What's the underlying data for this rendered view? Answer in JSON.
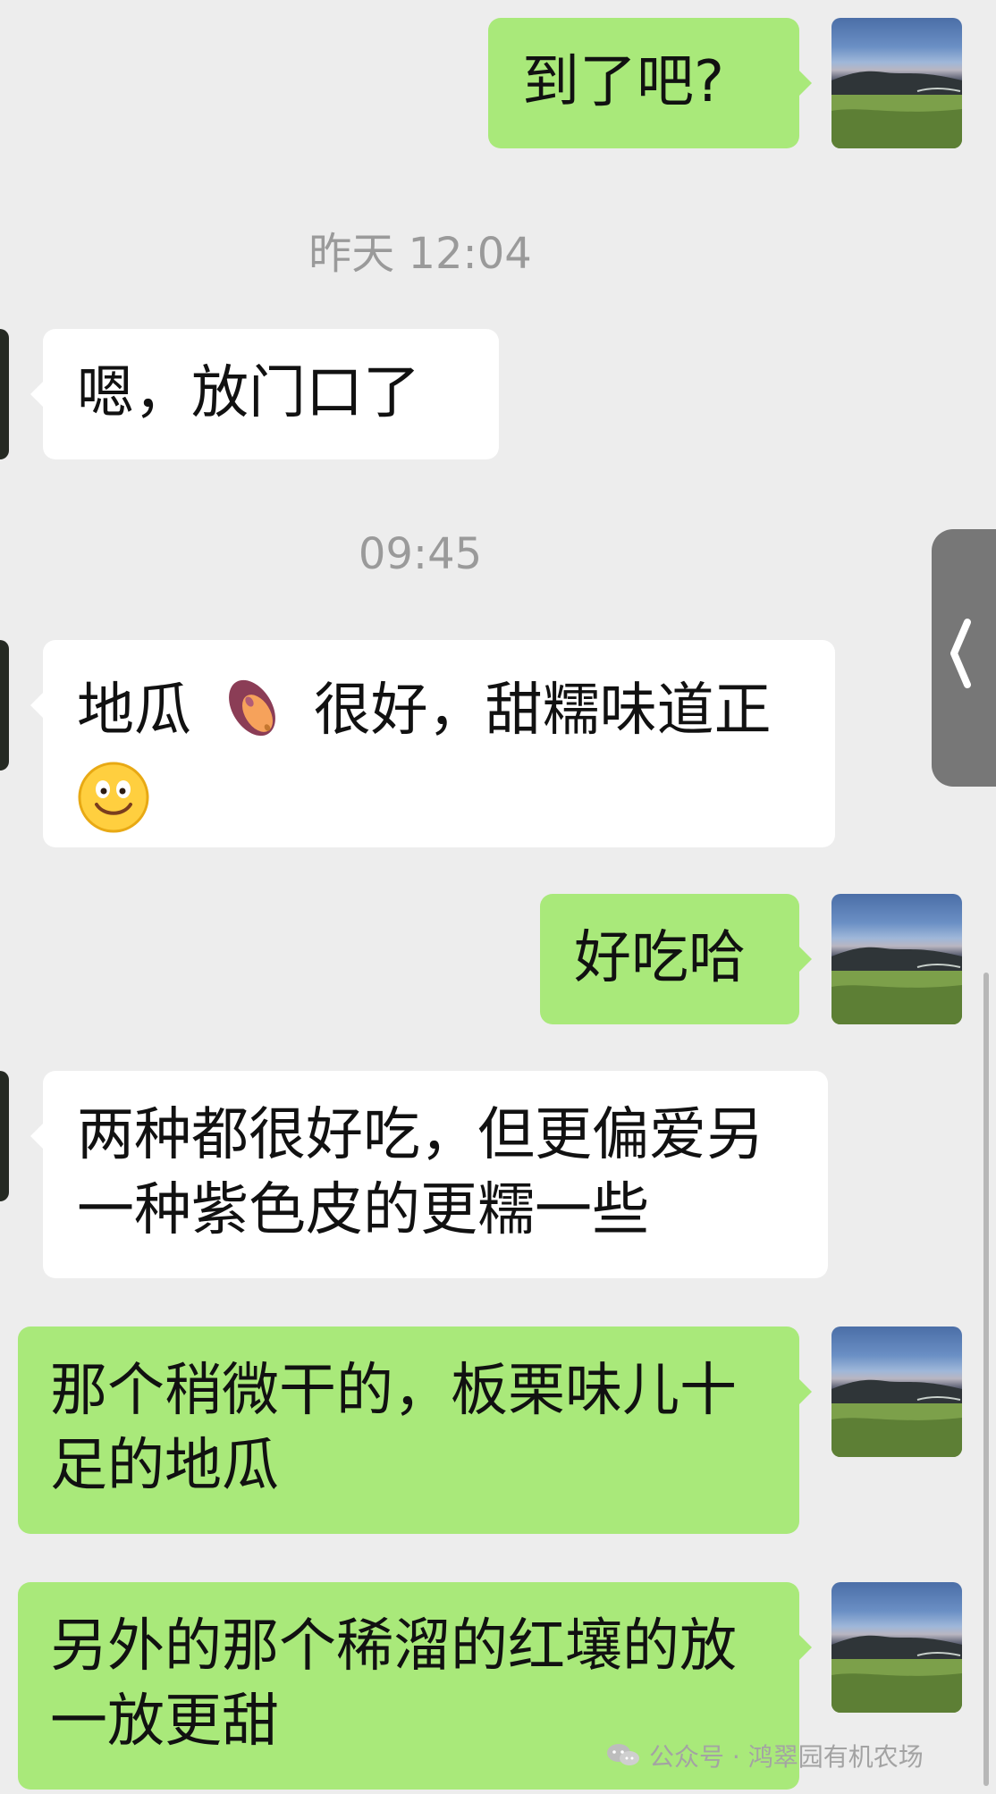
{
  "messages": [
    {
      "sender": "me",
      "text": "到了吧?"
    },
    {
      "sender": "peer",
      "text": "嗯，放门口了"
    },
    {
      "sender": "peer",
      "parts": [
        "地瓜",
        "很好，甜糯味道正"
      ]
    },
    {
      "sender": "me",
      "text": "好吃哈"
    },
    {
      "sender": "peer",
      "text": "两种都很好吃，但更偏爱另一种紫色皮的更糯一些"
    },
    {
      "sender": "me",
      "text": "那个稍微干的，板栗味儿十足的地瓜"
    },
    {
      "sender": "me",
      "text": "另外的那个稀溜的红壤的放一放更甜"
    }
  ],
  "timestamps": [
    "昨天 12:04",
    "09:45"
  ],
  "watermark": {
    "text": "公众号 · 鸿翠园有机农场"
  },
  "icons": [
    "avatar-icon",
    "potato-emoji-icon",
    "smile-emoji-icon",
    "chevron-left-icon",
    "wechat-icon"
  ]
}
